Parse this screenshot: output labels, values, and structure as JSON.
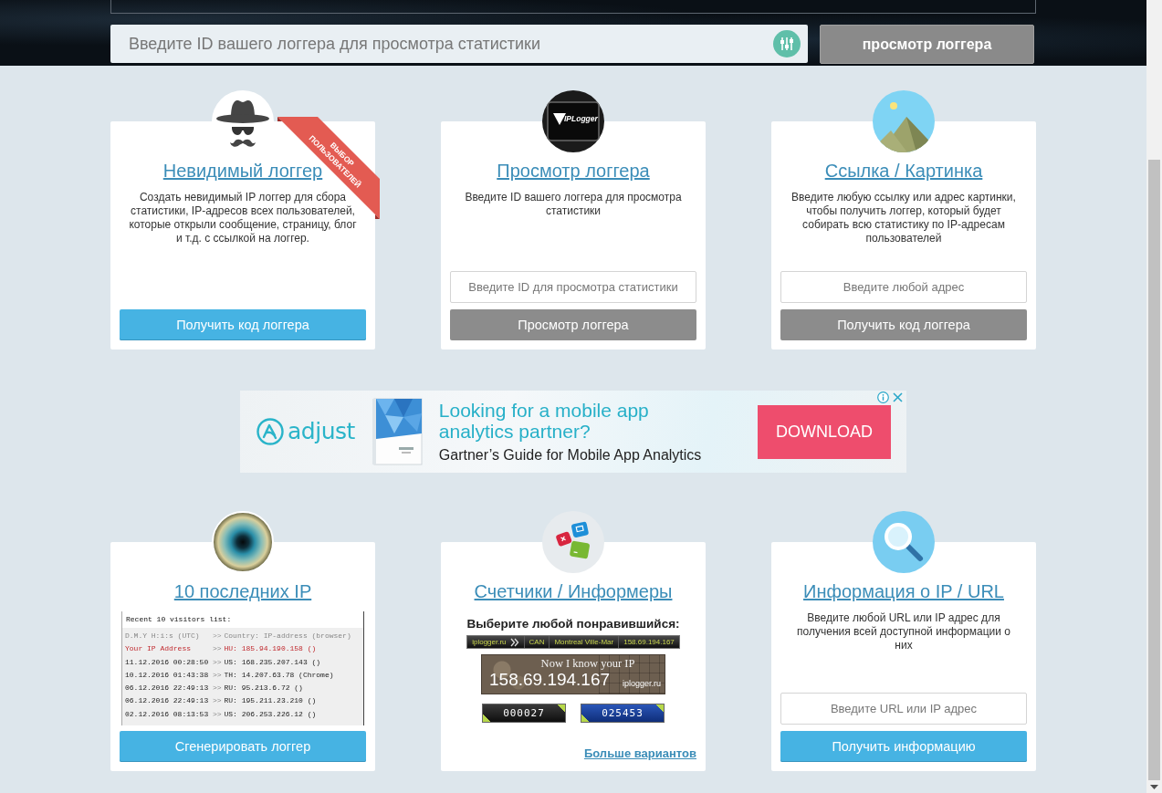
{
  "header": {
    "search": {
      "placeholder": "Введите ID вашего логгера для просмотра статистики"
    },
    "button": "просмотр логгера"
  },
  "top_cards": [
    {
      "title": "Невидимый логгер",
      "ribbon": [
        "ВЫБОР",
        "ПОЛЬЗОВАТЕЛЕЙ"
      ],
      "description": "Создать невидимый IP логгер для сбора статистики, IP-адресов всех пользователей, которые открыли сообщение, страницу, блог и т.д. с ссылкой на логгер.",
      "button": {
        "label": "Получить код логгера",
        "kind": "primary"
      }
    },
    {
      "title": "Просмотр логгера",
      "logo_text": "IPLogger",
      "description": "Введите ID вашего логгера для просмотра статистики",
      "field": {
        "placeholder": "Введите ID для просмотра статистики"
      },
      "button": {
        "label": "Просмотр логгера",
        "kind": "secondary"
      }
    },
    {
      "title": "Ссылка / Картинка",
      "description": "Введите любую ссылку или адрес картинки, чтобы получить логгер, который будет собирать всю статистику по IP-адресам пользователей",
      "field": {
        "placeholder": "Введите любой адрес"
      },
      "button": {
        "label": "Получить код логгера",
        "kind": "secondary"
      }
    }
  ],
  "ad": {
    "logo": "adjust",
    "headline": "Looking for a mobile app analytics partner?",
    "subline": "Gartner’s Guide for Mobile App Analytics",
    "button": "DOWNLOAD"
  },
  "bottom_cards": [
    {
      "kind": "list",
      "title": "10 последних IP",
      "list": {
        "caption": "Recent 10 visitors list:",
        "rows": [
          {
            "kind": "legend",
            "time": "D.M.Y H:i:s (UTC)",
            "separator": ">>",
            "entry": "Country: IP-address (browser)"
          },
          {
            "kind": "self",
            "time": "Your IP Address",
            "separator": ">>",
            "entry": "HU: 185.94.190.158 ()"
          },
          {
            "kind": "visitor",
            "time": "11.12.2016 00:28:50",
            "separator": ">>",
            "entry": "US: 168.235.207.143 ()"
          },
          {
            "kind": "visitor",
            "time": "10.12.2016 01:43:38",
            "separator": ">>",
            "entry": "TH: 14.207.63.78 (Chrome)"
          },
          {
            "kind": "visitor",
            "time": "06.12.2016 22:49:13",
            "separator": ">>",
            "entry": "RU: 95.213.6.72 ()"
          },
          {
            "kind": "visitor",
            "time": "06.12.2016 22:49:13",
            "separator": ">>",
            "entry": "RU: 195.211.23.210 ()"
          },
          {
            "kind": "visitor",
            "time": "02.12.2016 08:13:53",
            "separator": ">>",
            "entry": "US: 206.253.226.12 ()"
          }
        ]
      },
      "button": {
        "label": "Сгенерировать логгер",
        "kind": "primary"
      }
    },
    {
      "kind": "informers",
      "title": "Счетчики / Информеры",
      "prompt": "Выберите любой понравившийся:",
      "bar": {
        "segments": [
          "iplogger.ru",
          "CAN",
          "Montreal Ville-Mar",
          "158.69.194.167"
        ]
      },
      "banner": {
        "caption": "Now I know your IP",
        "ip": "158.69.194.167",
        "site": "iplogger.ru"
      },
      "counters": [
        {
          "kind": "dark",
          "value": "000027"
        },
        {
          "kind": "blue",
          "value": "025453"
        }
      ],
      "link": "Больше вариантов"
    },
    {
      "kind": "lookup",
      "title": "Информация о IP / URL",
      "description": "Введите любой URL или IP адрес для получения всей доступной информации о них",
      "field": {
        "placeholder": "Введите URL или IP адрес"
      },
      "button": {
        "label": "Получить информацию",
        "kind": "primary"
      }
    }
  ]
}
